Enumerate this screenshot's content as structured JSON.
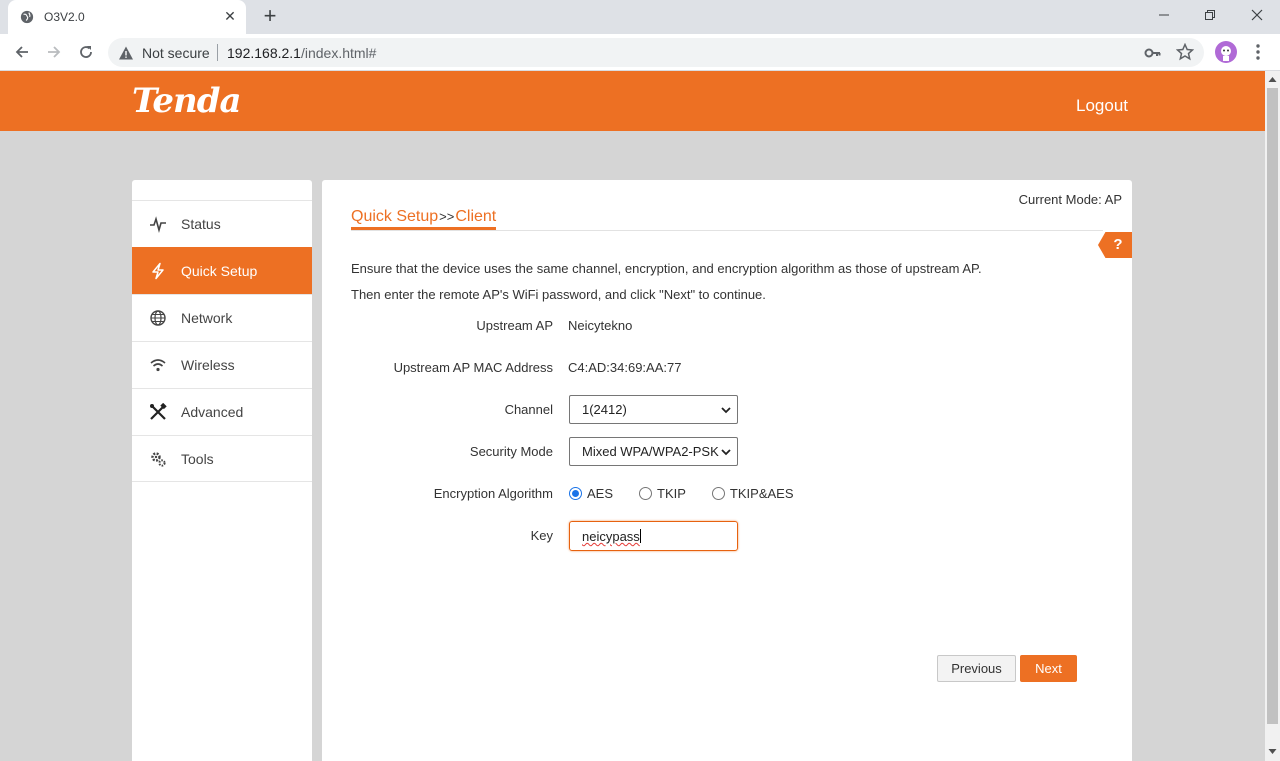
{
  "browser": {
    "tab_title": "O3V2.0",
    "not_secure": "Not secure",
    "url_host": "192.168.2.1",
    "url_path": "/index.html#"
  },
  "header": {
    "logo": "Tenda",
    "logout": "Logout"
  },
  "sidebar": {
    "items": [
      {
        "label": "Status",
        "icon": "status-pulse-icon"
      },
      {
        "label": "Quick Setup",
        "icon": "lightning-icon"
      },
      {
        "label": "Network",
        "icon": "globe-icon"
      },
      {
        "label": "Wireless",
        "icon": "wifi-icon"
      },
      {
        "label": "Advanced",
        "icon": "tools-cross-icon"
      },
      {
        "label": "Tools",
        "icon": "gears-icon"
      }
    ]
  },
  "main": {
    "current_mode": "Current Mode: AP",
    "breadcrumb_1": "Quick Setup",
    "breadcrumb_sep": ">>",
    "breadcrumb_2": "Client",
    "help": "?",
    "intro_line1": "Ensure that the device uses the same channel, encryption, and encryption algorithm as those of upstream AP.",
    "intro_line2": "Then enter the remote AP's WiFi password, and click \"Next\" to continue.",
    "fields": {
      "upstream_ap_label": "Upstream AP",
      "upstream_ap_value": "Neicytekno",
      "mac_label": "Upstream AP MAC Address",
      "mac_value": "C4:AD:34:69:AA:77",
      "channel_label": "Channel",
      "channel_value": "1(2412)",
      "security_label": "Security Mode",
      "security_value": "Mixed WPA/WPA2-PSK",
      "encryption_label": "Encryption Algorithm",
      "encryption_options": [
        "AES",
        "TKIP",
        "TKIP&AES"
      ],
      "encryption_selected": "AES",
      "key_label": "Key",
      "key_value": "neicypass"
    },
    "buttons": {
      "previous": "Previous",
      "next": "Next"
    }
  },
  "colors": {
    "brand_orange": "#ed7023",
    "page_background": "#d5d5d5"
  }
}
